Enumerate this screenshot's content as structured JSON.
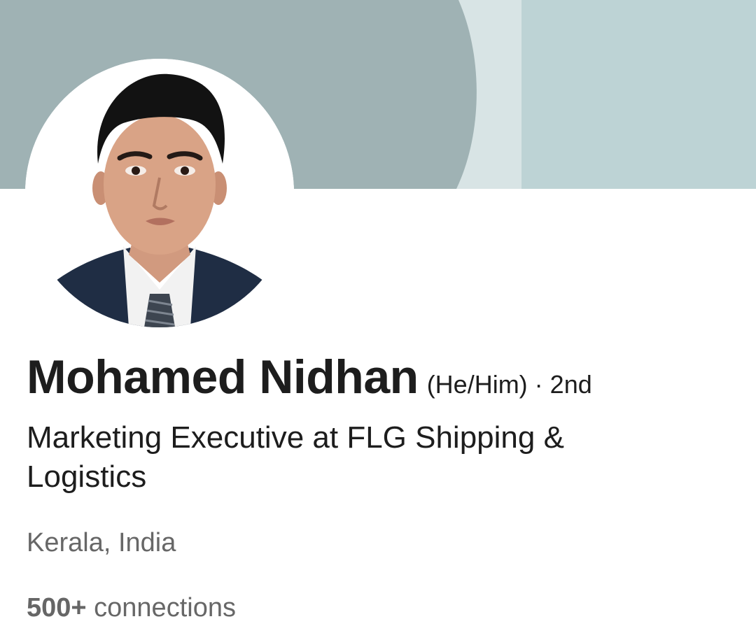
{
  "profile": {
    "name": "Mohamed Nidhan",
    "pronouns": "(He/Him)",
    "separator": "·",
    "degree": "2nd",
    "headline": "Marketing Executive at FLG Shipping & Logistics",
    "location": "Kerala, India",
    "connections_count": "500+",
    "connections_label": "connections"
  },
  "colors": {
    "cover_dark": "#9fb2b4",
    "cover_stripe": "#d8e4e5",
    "cover_light": "#bdd3d5",
    "text_primary": "#1d1d1d",
    "text_secondary": "#676767"
  },
  "icons": {
    "avatar": "profile-photo"
  }
}
